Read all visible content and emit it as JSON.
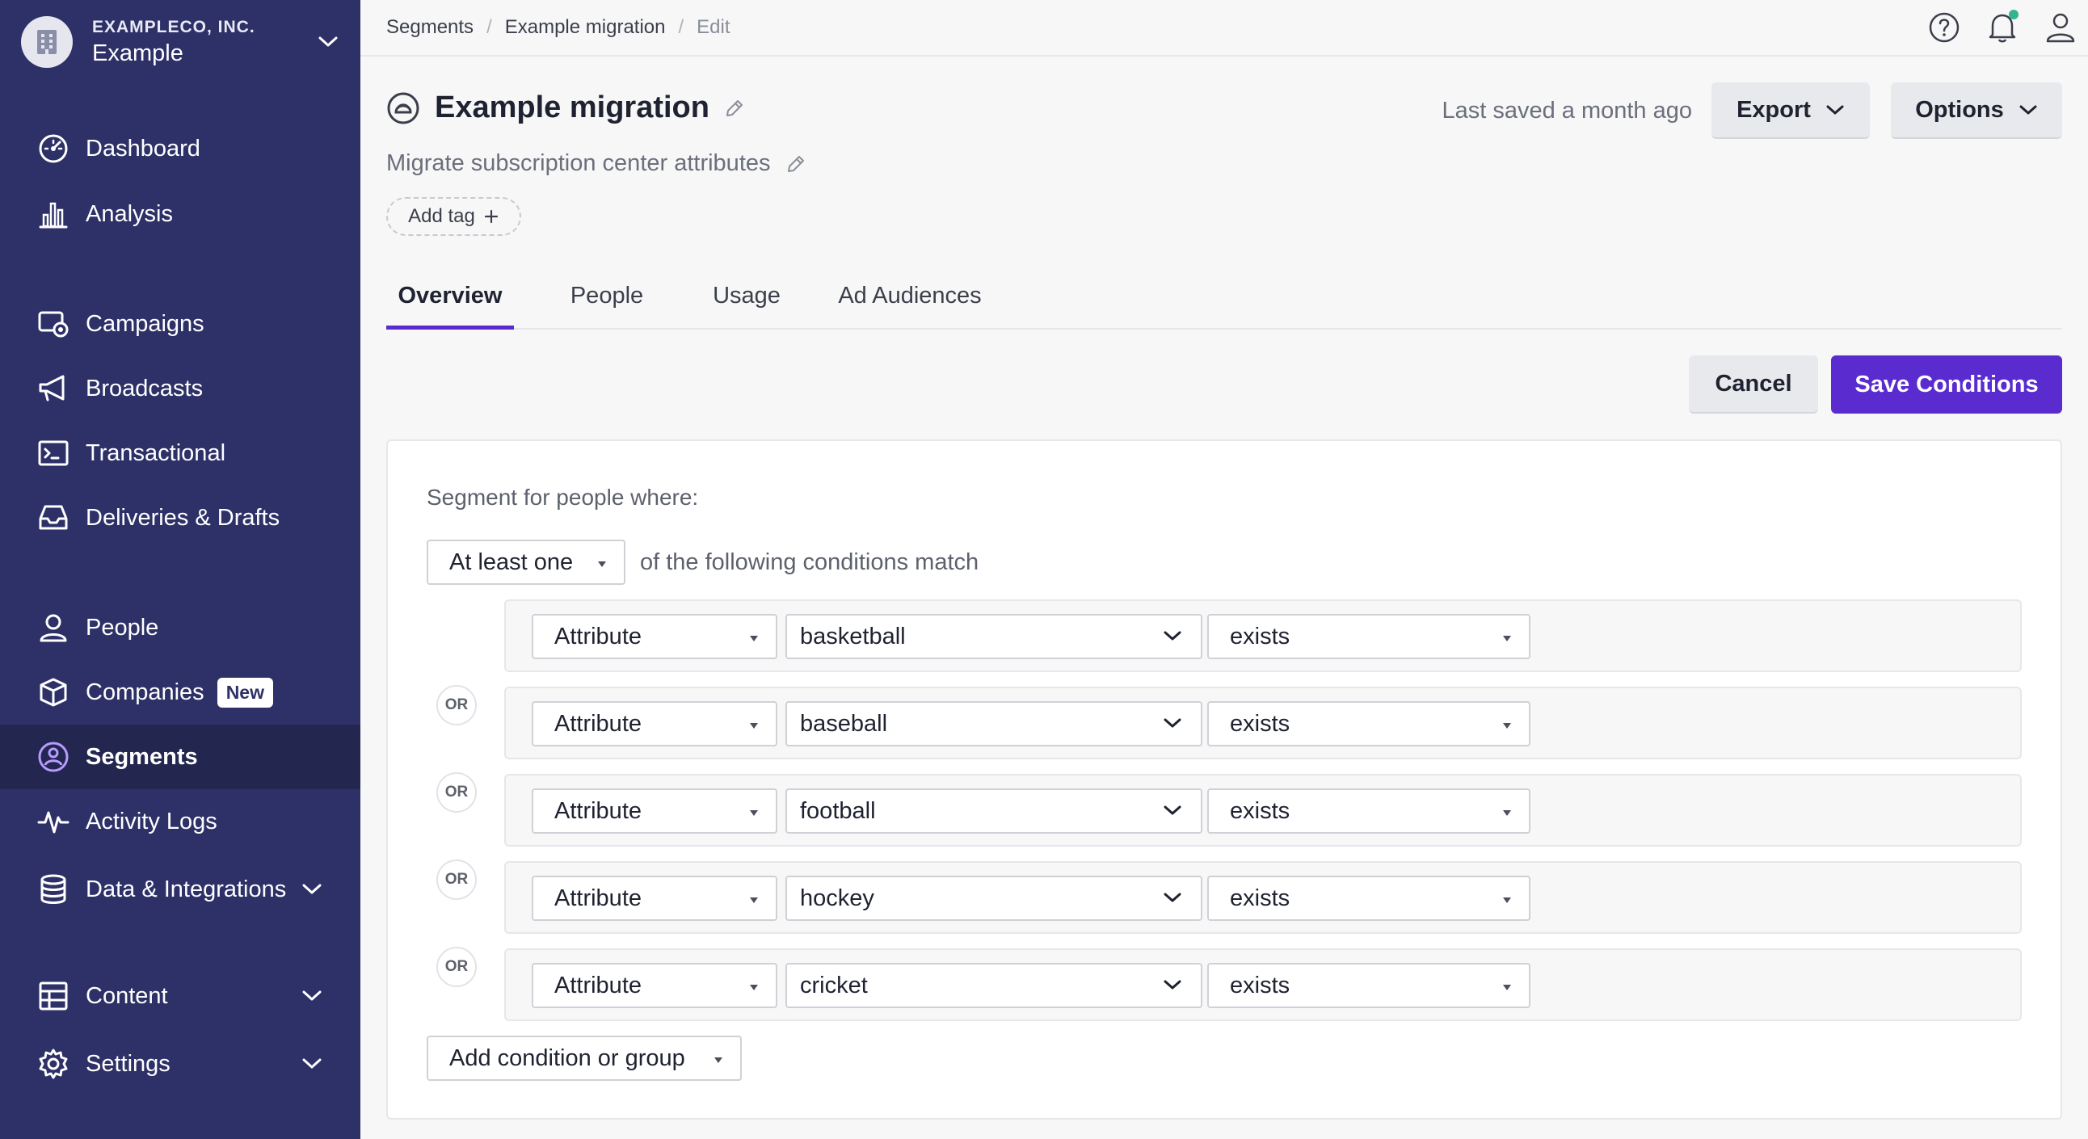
{
  "org": {
    "name": "EXAMPLECO, INC.",
    "workspace": "Example"
  },
  "nav": {
    "dashboard": "Dashboard",
    "analysis": "Analysis",
    "campaigns": "Campaigns",
    "broadcasts": "Broadcasts",
    "transactional": "Transactional",
    "deliveries": "Deliveries & Drafts",
    "people": "People",
    "companies": "Companies",
    "companies_badge": "New",
    "segments": "Segments",
    "activity_logs": "Activity Logs",
    "data_integrations": "Data & Integrations",
    "content": "Content",
    "settings": "Settings"
  },
  "breadcrumb": [
    "Segments",
    "Example migration",
    "Edit"
  ],
  "header": {
    "title": "Example migration",
    "description": "Migrate subscription center attributes",
    "add_tag": "Add tag",
    "last_saved": "Last saved a month ago",
    "export": "Export",
    "options": "Options"
  },
  "tabs": [
    "Overview",
    "People",
    "Usage",
    "Ad Audiences"
  ],
  "actions": {
    "cancel": "Cancel",
    "save": "Save Conditions"
  },
  "segment": {
    "label": "Segment for people where:",
    "match_value": "At least one",
    "match_suffix": "of the following conditions match",
    "or_label": "OR",
    "conditions": [
      {
        "type": "Attribute",
        "value": "basketball",
        "operator": "exists"
      },
      {
        "type": "Attribute",
        "value": "baseball",
        "operator": "exists"
      },
      {
        "type": "Attribute",
        "value": "football",
        "operator": "exists"
      },
      {
        "type": "Attribute",
        "value": "hockey",
        "operator": "exists"
      },
      {
        "type": "Attribute",
        "value": "cricket",
        "operator": "exists"
      }
    ],
    "add_condition": "Add condition or group"
  },
  "colors": {
    "sidebar": "#2e3167",
    "sidebar_active": "#23264f",
    "accent": "#5a2ccf",
    "notification_dot": "#32b58f"
  }
}
